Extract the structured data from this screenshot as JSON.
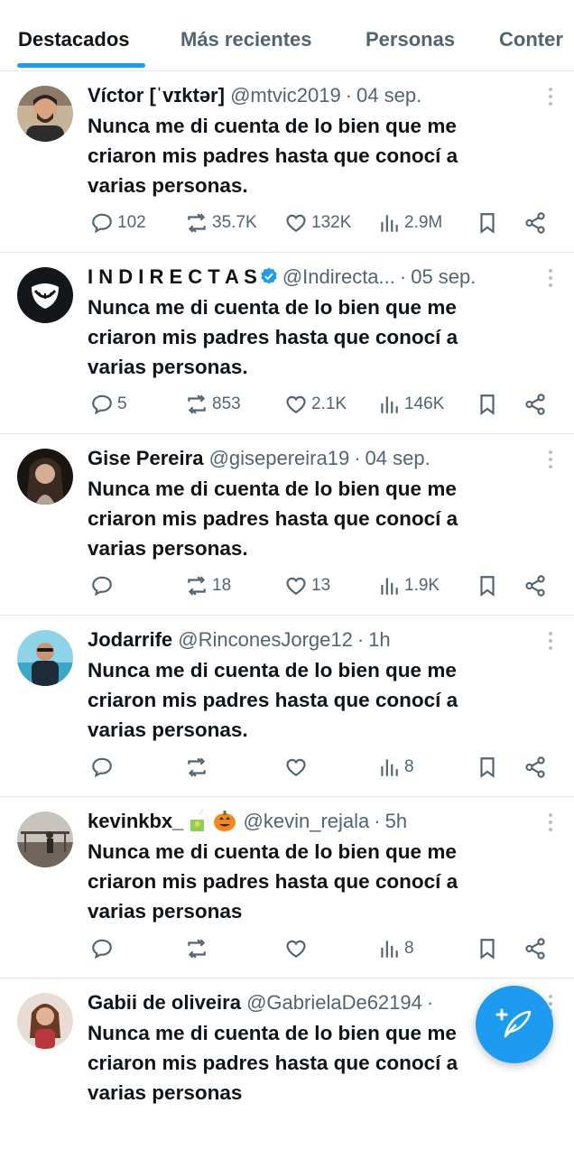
{
  "tabs": [
    {
      "label": "Destacados",
      "active": true
    },
    {
      "label": "Más recientes",
      "active": false
    },
    {
      "label": "Personas",
      "active": false
    },
    {
      "label": "Conter",
      "active": false
    }
  ],
  "tweets": [
    {
      "name": "Víctor [ˈvɪktər]",
      "handle": "@mtvic2019",
      "time": "04 sep.",
      "text": "Nunca me di cuenta de lo bien que me\ncriaron mis padres hasta que conocí a\nvarias personas.",
      "replies": "102",
      "reposts": "35.7K",
      "likes": "132K",
      "views": "2.9M"
    },
    {
      "name": "I N D I R E C T A S",
      "handle": "@Indirecta...",
      "time": "05 sep.",
      "verified": true,
      "text": "Nunca me di cuenta de lo bien que me\ncriaron mis padres hasta que conocí a\nvarias personas.",
      "replies": "5",
      "reposts": "853",
      "likes": "2.1K",
      "views": "146K"
    },
    {
      "name": "Gise Pereira",
      "handle": "@gisepereira19",
      "time": "04 sep.",
      "text": "Nunca me di cuenta de lo bien que me\ncriaron mis padres hasta que conocí a\nvarias personas.",
      "replies": "",
      "reposts": "18",
      "likes": "13",
      "views": "1.9K"
    },
    {
      "name": "Jodarrife",
      "handle": "@RinconesJorge12",
      "time": "1h",
      "text": "Nunca me di cuenta de lo bien que me\ncriaron mis padres hasta que conocí a\nvarias personas.",
      "replies": "",
      "reposts": "",
      "likes": "",
      "views": "8"
    },
    {
      "name": "kevinkbx_",
      "handle": "@kevin_rejala",
      "time": "5h",
      "emoji": [
        "juice-box-emoji",
        "jack-o-lantern-emoji"
      ],
      "text": "Nunca me di cuenta de lo bien que me\ncriaron mis padres hasta que conocí a\nvarias personas",
      "replies": "",
      "reposts": "",
      "likes": "",
      "views": "8"
    },
    {
      "name": "Gabii de oliveira",
      "handle": "@GabrielaDe62194",
      "time": "",
      "text": "Nunca me di cuenta de lo bien que me\ncriaron mis padres hasta que conocí a\nvarias personas",
      "replies": "",
      "reposts": "",
      "likes": "",
      "views": ""
    }
  ],
  "icons": {
    "reply": "reply-icon",
    "repost": "repost-icon",
    "like": "like-icon",
    "views": "views-icon",
    "bookmark": "bookmark-icon",
    "share": "share-icon",
    "more": "more-icon",
    "compose": "compose-post-icon",
    "verified": "verified-badge-icon"
  },
  "colors": {
    "accent": "#1d9bf0",
    "text": "#0f1419",
    "secondary_text": "#536471",
    "divider": "#e6e8ea"
  }
}
